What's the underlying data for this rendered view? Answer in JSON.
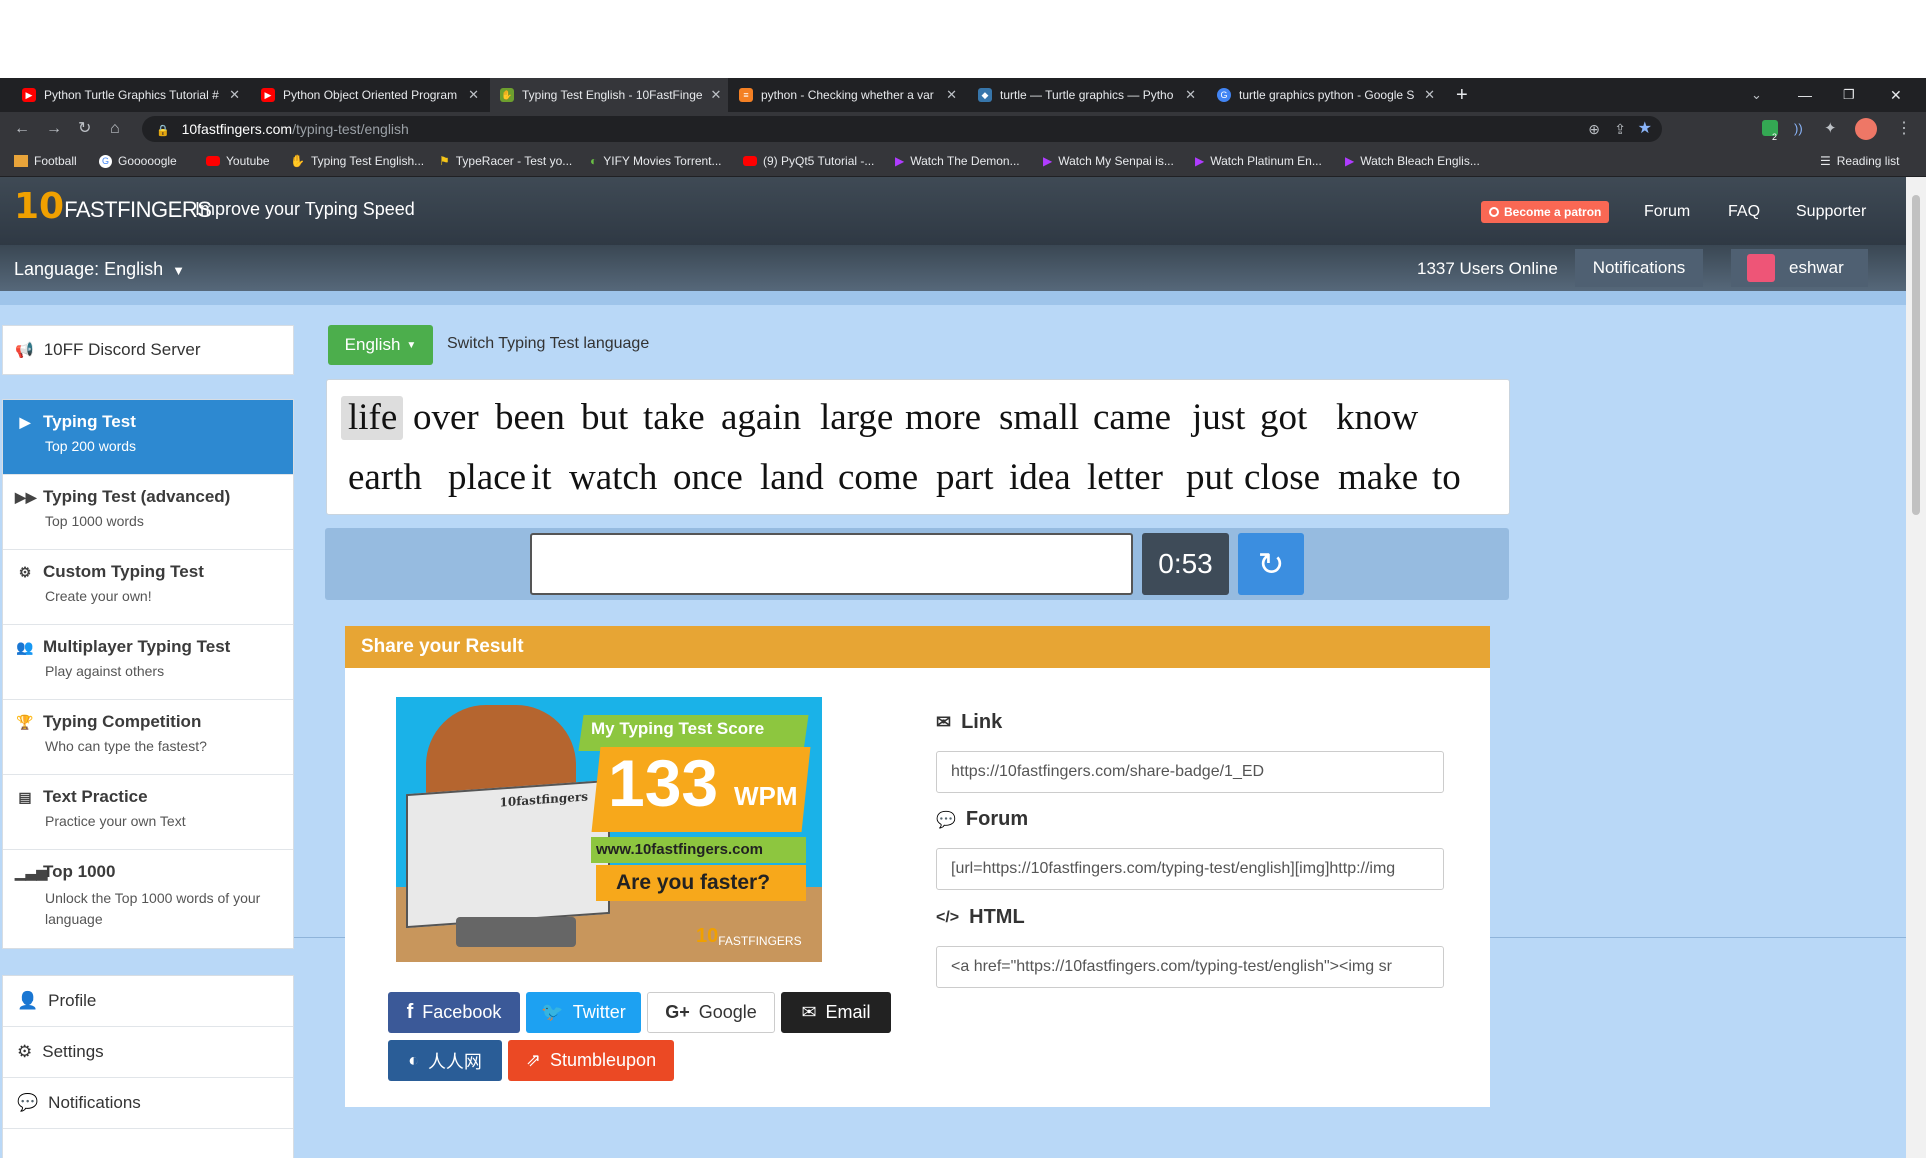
{
  "browser": {
    "tabs": [
      {
        "title": "Python Turtle Graphics Tutorial #",
        "favicon": "youtube-icon",
        "color": "#ff0000"
      },
      {
        "title": "Python Object Oriented Program",
        "favicon": "youtube-icon",
        "color": "#ff0000"
      },
      {
        "title": "Typing Test English - 10FastFinge",
        "favicon": "10ff-icon",
        "color": "#6d9f2e"
      },
      {
        "title": "python - Checking whether a var",
        "favicon": "stackoverflow-icon",
        "color": "#f48024"
      },
      {
        "title": "turtle — Turtle graphics — Pytho",
        "favicon": "python-icon",
        "color": "#3776ab"
      },
      {
        "title": "turtle graphics python - Google S",
        "favicon": "google-icon",
        "color": "#4285f4"
      }
    ],
    "url_domain": "10fastfingers.com",
    "url_path": "/typing-test/english",
    "bookmarks": [
      "Football",
      "Gooooogle",
      "Youtube",
      "Typing Test English...",
      "TypeRacer - Test yo...",
      "YIFY Movies Torrent...",
      "(9) PyQt5 Tutorial -...",
      "Watch The Demon...",
      "Watch My Senpai is...",
      "Watch Platinum En...",
      "Watch Bleach Englis..."
    ],
    "reading_list": "Reading list",
    "extension_badge": "2"
  },
  "site": {
    "logo_num": "10",
    "logo_text": "FASTFINGERS",
    "tagline": "Improve your Typing Speed",
    "patron_label": "Become a patron",
    "nav": [
      "Forum",
      "FAQ",
      "Supporter"
    ],
    "language_label": "Language: English",
    "users_online": "1337 Users Online",
    "notifications_label": "Notifications",
    "username": "eshwar"
  },
  "sidebar": {
    "discord": "10FF Discord Server",
    "items": [
      {
        "title": "Typing Test",
        "sub": "Top 200 words",
        "icon": "play-icon"
      },
      {
        "title": "Typing Test (advanced)",
        "sub": "Top 1000 words",
        "icon": "fast-forward-icon"
      },
      {
        "title": "Custom Typing Test",
        "sub": "Create your own!",
        "icon": "gears-icon"
      },
      {
        "title": "Multiplayer Typing Test",
        "sub": "Play against others",
        "icon": "users-icon"
      },
      {
        "title": "Typing Competition",
        "sub": "Who can type the fastest?",
        "icon": "trophy-icon"
      },
      {
        "title": "Text Practice",
        "sub": "Practice your own Text",
        "icon": "document-icon"
      },
      {
        "title": "Top 1000",
        "sub": "Unlock the Top 1000 words of your language",
        "icon": "signal-icon"
      }
    ],
    "account": [
      "Profile",
      "Settings",
      "Notifications"
    ]
  },
  "test": {
    "language_button": "English",
    "switch_label": "Switch Typing Test language",
    "line1": [
      "life",
      "over",
      "been",
      "but",
      "take",
      "again",
      "large",
      "more",
      "small",
      "came",
      "just",
      "got",
      "know"
    ],
    "line2": [
      "earth",
      "place",
      "it",
      "watch",
      "once",
      "land",
      "come",
      "part",
      "idea",
      "letter",
      "put",
      "close",
      "make",
      "to"
    ],
    "input_value": "",
    "timer": "0:53"
  },
  "share": {
    "title": "Share your Result",
    "badge": {
      "heading": "My Typing Test Score",
      "wpm": "133",
      "unit": "WPM",
      "site": "www.10fastfingers.com",
      "question": "Are you faster?",
      "paper_text": "10fastfingers",
      "logo_num": "10",
      "logo_text": "FASTFINGERS"
    },
    "link_label": "Link",
    "link_value": "https://10fastfingers.com/share-badge/1_ED",
    "forum_label": "Forum",
    "forum_value": "[url=https://10fastfingers.com/typing-test/english][img]http://img",
    "html_label": "HTML",
    "html_value": "<a href=\"https://10fastfingers.com/typing-test/english\"><img sr",
    "buttons": [
      {
        "label": "Facebook",
        "color": "#3b5998"
      },
      {
        "label": "Twitter",
        "color": "#1da1f2"
      },
      {
        "label": "Google",
        "color": "#ffffff"
      },
      {
        "label": "Email",
        "color": "#222222"
      },
      {
        "label": "人人网",
        "color": "#2a5d97"
      },
      {
        "label": "Stumbleupon",
        "color": "#eb4924"
      }
    ]
  }
}
